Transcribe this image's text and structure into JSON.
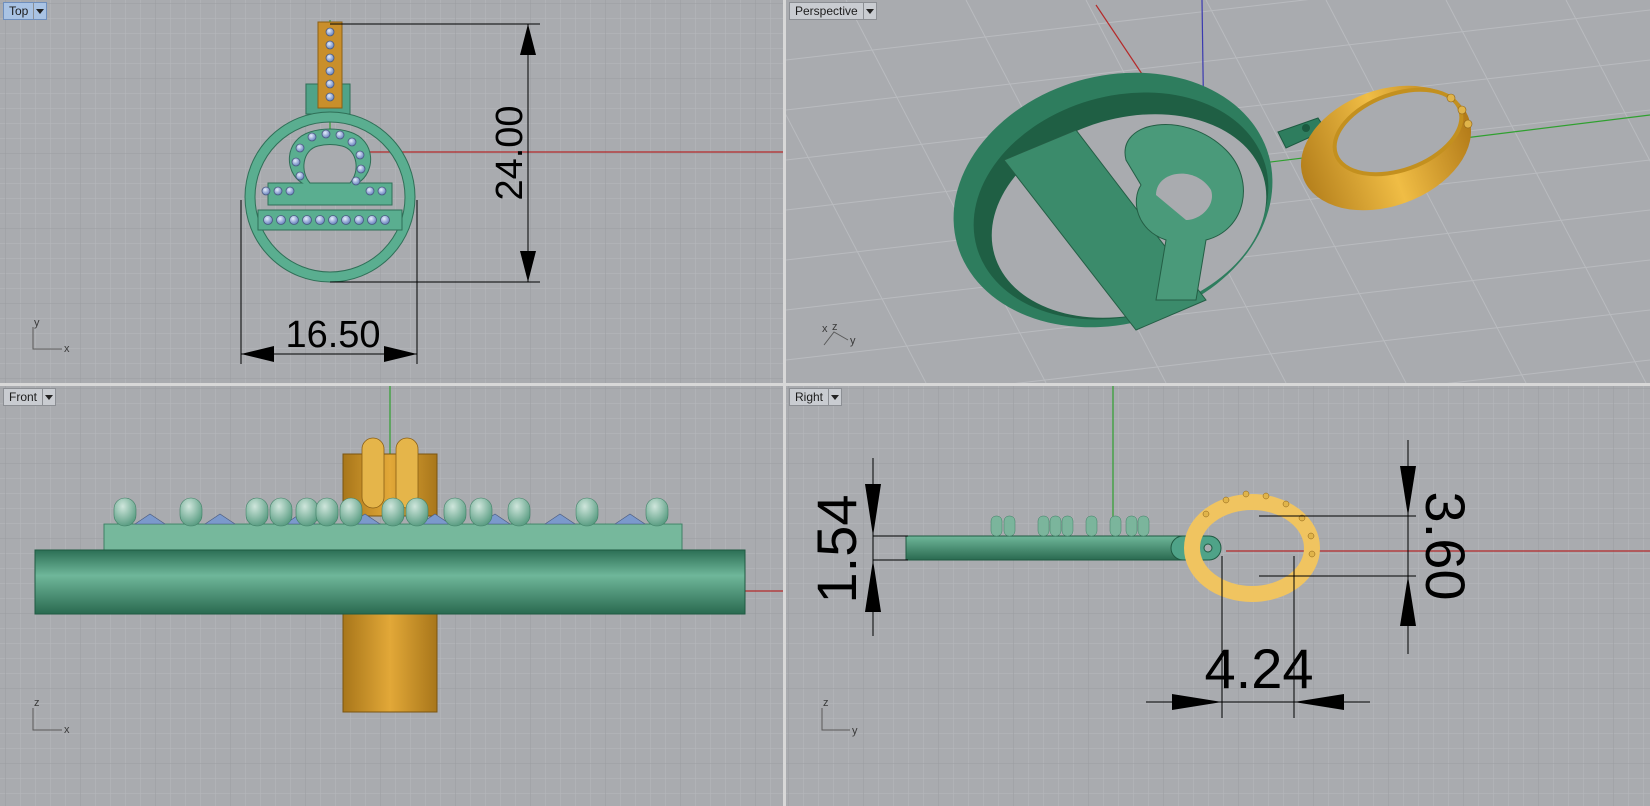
{
  "viewports": {
    "top": {
      "label": "Top",
      "active": true,
      "dims": {
        "height": "24.00",
        "width": "16.50"
      },
      "axes": {
        "a": "y",
        "b": "x"
      }
    },
    "perspective": {
      "label": "Perspective",
      "active": false,
      "axes": {
        "a": "z",
        "b": "x",
        "c": "y"
      }
    },
    "front": {
      "label": "Front",
      "active": false,
      "axes": {
        "a": "z",
        "b": "x"
      }
    },
    "right": {
      "label": "Right",
      "active": false,
      "dims": {
        "thickness": "1.54",
        "ring_height": "3.60",
        "ring_width": "4.24"
      },
      "axes": {
        "a": "z",
        "b": "y"
      }
    }
  },
  "colors": {
    "viewport_bg": "#a9abaf",
    "grid_minor": "#b6b8bc",
    "grid_major": "#97999d",
    "green_body": "#3f8f6e",
    "gold": "#d9a63a",
    "gem": "#8fa9d4",
    "x_axis": "#b52a2a",
    "y_axis": "#2fa02f",
    "z_axis": "#3a3ab0"
  },
  "icons": {
    "dropdown": "chevron-down-icon"
  }
}
